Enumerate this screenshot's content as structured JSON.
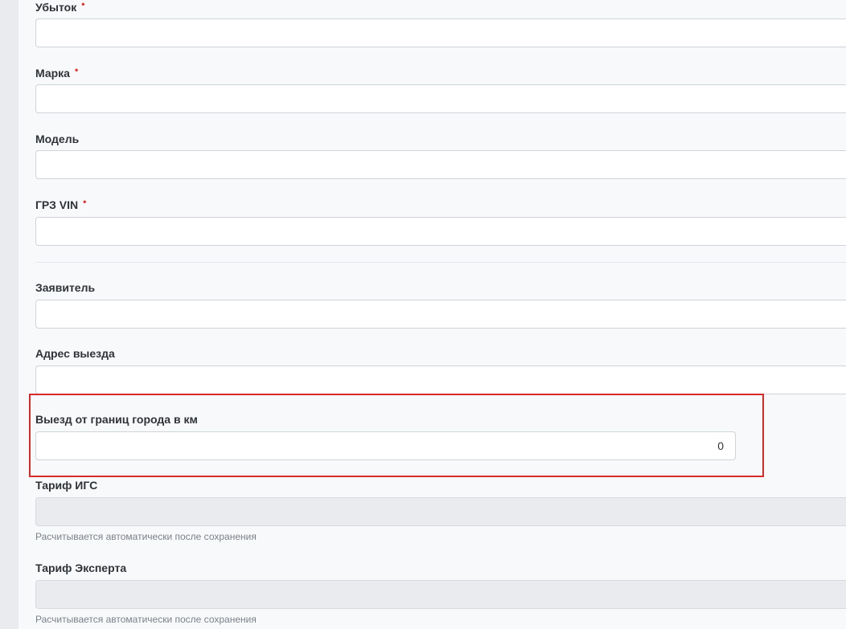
{
  "form": {
    "fields": {
      "ubytok": {
        "label": "Убыток",
        "required": true,
        "value": ""
      },
      "marka": {
        "label": "Марка",
        "required": true,
        "value": ""
      },
      "model": {
        "label": "Модель",
        "required": false,
        "value": ""
      },
      "grz_vin": {
        "label": "ГРЗ VIN",
        "required": true,
        "value": ""
      },
      "zayavitel": {
        "label": "Заявитель",
        "required": false,
        "value": ""
      },
      "adres": {
        "label": "Адрес выезда",
        "required": false,
        "value": ""
      },
      "km": {
        "label": "Выезд от границ города в км",
        "required": false,
        "value": "0"
      },
      "tarif_igs": {
        "label": "Тариф ИГС",
        "required": false,
        "value": "",
        "hint": "Расчитывается автоматически после сохранения"
      },
      "tarif_experta": {
        "label": "Тариф Эксперта",
        "required": false,
        "value": "",
        "hint": "Расчитывается автоматически после сохранения"
      }
    },
    "required_marker": "•"
  },
  "colors": {
    "required_marker": "#e5322d",
    "highlight_border": "#d92a2a",
    "panel_bg": "#f8f9fb",
    "sidebar_bg": "#e9ebef"
  }
}
